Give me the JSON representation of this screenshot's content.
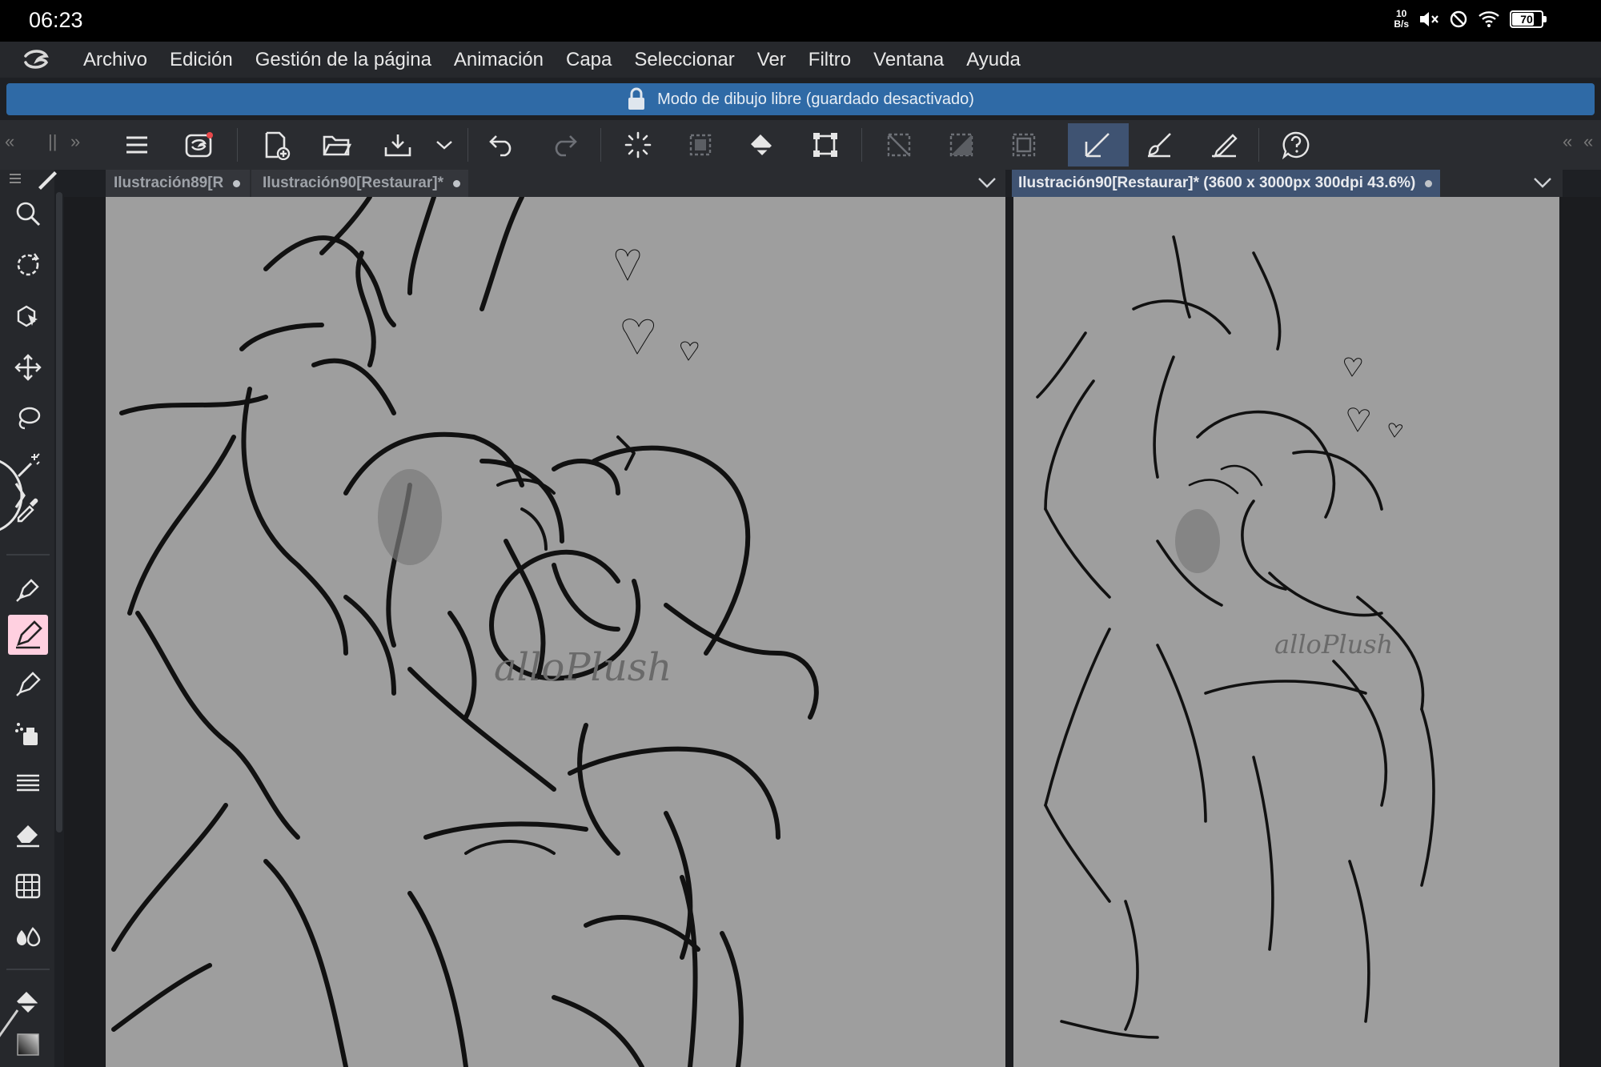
{
  "status_bar": {
    "time": "06:23",
    "net_speed_value": "10",
    "net_speed_unit": "B/s",
    "battery": "70",
    "icons": [
      "mute-icon",
      "do-not-disturb-icon",
      "wifi-icon",
      "battery-icon"
    ]
  },
  "menu": {
    "items": [
      "Archivo",
      "Edición",
      "Gestión de la página",
      "Animación",
      "Capa",
      "Seleccionar",
      "Ver",
      "Filtro",
      "Ventana",
      "Ayuda"
    ]
  },
  "banner": {
    "text": "Modo de dibujo libre (guardado desactivado)",
    "icon": "lock-icon",
    "color": "#2f6aa6"
  },
  "toolbar": {
    "icons": [
      "menu-icon",
      "clip-studio-icon",
      "new-canvas-icon",
      "open-folder-icon",
      "save-icon",
      "more-chevron-icon",
      "undo-icon",
      "redo-icon",
      "loading-icon",
      "clear-selection-icon",
      "fill-icon",
      "transform-icon",
      "deselect-icon",
      "invert-selection-icon",
      "show-selection-icon",
      "pen-angle-icon",
      "brush-stabilize-icon",
      "pen-pressure-icon",
      "help-icon"
    ],
    "active_color": "#3f5372"
  },
  "left_tools": {
    "icons": [
      "zoom-icon",
      "rotate-icon",
      "object-select-icon",
      "move-icon",
      "lasso-icon",
      "magic-wand-icon",
      "eyedropper-icon",
      "pen-icon",
      "pencil-icon",
      "brush-icon",
      "airbrush-icon",
      "lines-icon",
      "eraser-icon",
      "grid-icon",
      "blend-icon",
      "bucket-fill-icon",
      "color-swatch-icon"
    ],
    "active_tool": "pencil-icon",
    "active_color": "#ffd0e0"
  },
  "left_canvas": {
    "tabs": [
      {
        "label": "Ilustración89[R"
      },
      {
        "label": "Ilustración90[Restaurar]*"
      }
    ],
    "watermark": "alloPlush"
  },
  "right_canvas": {
    "tab_label": "Ilustración90[Restaurar]* (3600 x 3000px 300dpi 43.6%)",
    "watermark": "alloPlush"
  }
}
